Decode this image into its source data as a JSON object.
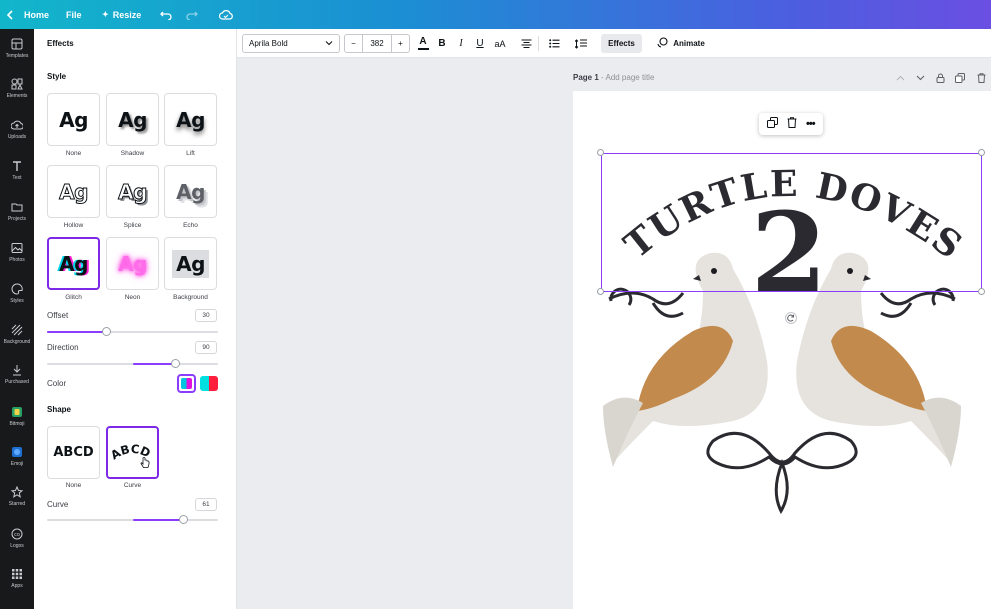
{
  "topbar": {
    "home_label": "Home",
    "file_label": "File",
    "resize_label": "Resize"
  },
  "rail": {
    "items": [
      {
        "label": "Templates",
        "icon": "templates-icon"
      },
      {
        "label": "Elements",
        "icon": "elements-icon"
      },
      {
        "label": "Uploads",
        "icon": "uploads-icon"
      },
      {
        "label": "Text",
        "icon": "text-icon"
      },
      {
        "label": "Projects",
        "icon": "projects-icon"
      },
      {
        "label": "Photos",
        "icon": "photos-icon"
      },
      {
        "label": "Styles",
        "icon": "styles-icon"
      },
      {
        "label": "Background",
        "icon": "background-icon"
      },
      {
        "label": "Purchased",
        "icon": "purchased-icon"
      },
      {
        "label": "Bitmoji",
        "icon": "bitmoji-icon"
      },
      {
        "label": "Emoji",
        "icon": "emoji-icon"
      },
      {
        "label": "Starred",
        "icon": "star-icon"
      },
      {
        "label": "Logos",
        "icon": "logos-icon"
      },
      {
        "label": "Apps",
        "icon": "apps-icon"
      }
    ]
  },
  "panel": {
    "title": "Effects",
    "style_heading": "Style",
    "styles": [
      {
        "sample": "Ag",
        "label": "None"
      },
      {
        "sample": "Ag",
        "label": "Shadow"
      },
      {
        "sample": "Ag",
        "label": "Lift"
      },
      {
        "sample": "Ag",
        "label": "Hollow"
      },
      {
        "sample": "Ag",
        "label": "Splice"
      },
      {
        "sample": "Ag",
        "label": "Echo"
      },
      {
        "sample": "Ag",
        "label": "Glitch"
      },
      {
        "sample": "Ag",
        "label": "Neon"
      },
      {
        "sample": "Ag",
        "label": "Background"
      }
    ],
    "selected_style": "Glitch",
    "offset": {
      "label": "Offset",
      "value": "30",
      "fraction": 0.35
    },
    "direction": {
      "label": "Direction",
      "value": "90",
      "fraction": 0.75
    },
    "color": {
      "label": "Color",
      "swatch1": [
        "#00c4e0",
        "#e012e0"
      ],
      "swatch2": [
        "#00e0e0",
        "#ff1e3c"
      ]
    },
    "shape_heading": "Shape",
    "shapes": [
      {
        "sample": "ABCD",
        "label": "None"
      },
      {
        "sample": "ABCD",
        "label": "Curve"
      }
    ],
    "selected_shape": "Curve",
    "curve": {
      "label": "Curve",
      "value": "61",
      "fraction": 0.8
    }
  },
  "toolbar": {
    "font": "Aprila Bold",
    "size": "382",
    "minus": "−",
    "plus": "+",
    "case_label": "aA",
    "effects_label": "Effects",
    "animate_label": "Animate"
  },
  "page": {
    "label": "Page 1",
    "title_placeholder": "- Add page title",
    "headline": "TURTLE DOVES",
    "number": "2"
  },
  "colors": {
    "accent": "#8b3dff",
    "topbar_start": "#12b6cb",
    "topbar_end": "#6a4fe2",
    "ink": "#2b2a30",
    "wing": "#c28a4d"
  }
}
